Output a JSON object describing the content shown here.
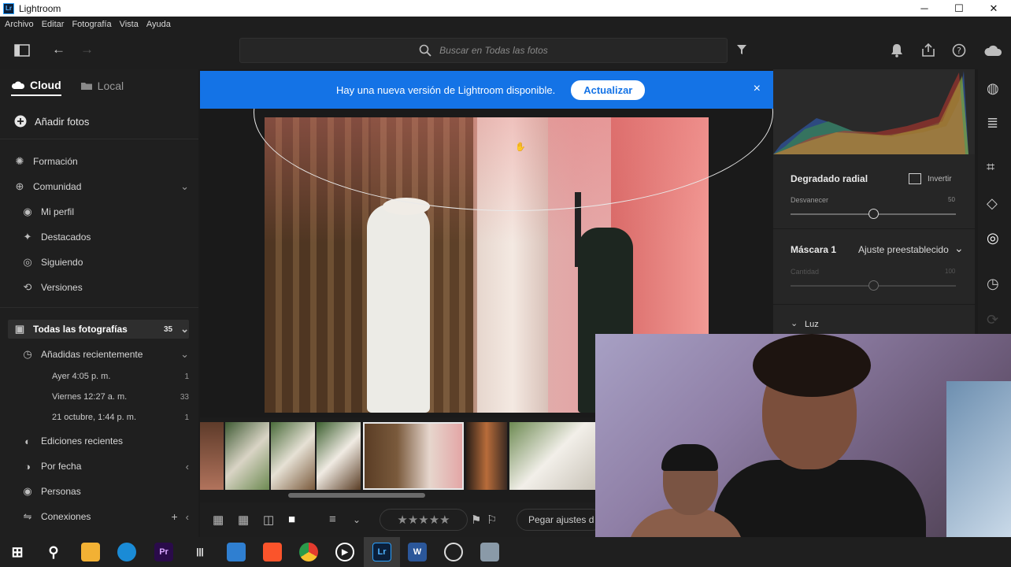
{
  "window": {
    "title": "Lightroom",
    "app_badge": "Lr",
    "controls": [
      "─",
      "☐",
      "✕"
    ]
  },
  "menu": [
    "Archivo",
    "Editar",
    "Fotografía",
    "Vista",
    "Ayuda"
  ],
  "search": {
    "placeholder": "Buscar en Todas las fotos"
  },
  "sidebar": {
    "tabs": [
      {
        "label": "Cloud",
        "active": true
      },
      {
        "label": "Local",
        "active": false
      }
    ],
    "add_photos": "Añadir fotos",
    "learn": "Formación",
    "community": {
      "label": "Comunidad",
      "items": [
        "Mi perfil",
        "Destacados",
        "Siguiendo",
        "Versiones"
      ]
    },
    "all_photos": {
      "label": "Todas las fotografías",
      "count": "35"
    },
    "recently_added": {
      "label": "Añadidas recientemente",
      "items": [
        {
          "label": "Ayer 4:05 p. m.",
          "count": "1"
        },
        {
          "label": "Viernes 12:27 a. m.",
          "count": "33"
        },
        {
          "label": "21 octubre, 1:44 p. m.",
          "count": "1"
        }
      ]
    },
    "recent_edits": "Ediciones recientes",
    "by_date": "Por fecha",
    "people": "Personas",
    "connections": "Conexiones"
  },
  "banner": {
    "text": "Hay una nueva versión de Lightroom disponible.",
    "button": "Actualizar",
    "close": "×"
  },
  "bottombar": {
    "stars": "★★★★★",
    "paste_label": "Pegar ajustes d"
  },
  "edit_panel": {
    "section_title": "Degradado radial",
    "invert_label": "Invertir",
    "feather_label": "Desvanecer",
    "feather_value": "50",
    "feather_fraction": 0.5,
    "mask_title": "Máscara 1",
    "preset_label": "Ajuste preestablecido",
    "amount_label": "Cantidad",
    "amount_value": "100",
    "amount_fraction": 0.5,
    "light_label": "Luz"
  },
  "taskbar": {
    "apps": [
      {
        "name": "start",
        "badge": "⊞"
      },
      {
        "name": "search",
        "badge": "⚲"
      },
      {
        "name": "file-explorer",
        "badge": ""
      },
      {
        "name": "edge",
        "badge": ""
      },
      {
        "name": "premiere",
        "badge": "Pr"
      },
      {
        "name": "audio-app",
        "badge": "|||"
      },
      {
        "name": "photos",
        "badge": ""
      },
      {
        "name": "brave",
        "badge": ""
      },
      {
        "name": "chrome",
        "badge": ""
      },
      {
        "name": "media-player",
        "badge": "▶"
      },
      {
        "name": "lightroom",
        "badge": "Lr"
      },
      {
        "name": "word",
        "badge": "W"
      },
      {
        "name": "speedtest",
        "badge": ""
      },
      {
        "name": "camera",
        "badge": ""
      }
    ],
    "colors": {
      "premiere": "#2a0b4a",
      "lightroom": "#0b1f3a",
      "word": "#2b579a",
      "chrome": "#e33b2e",
      "edge": "#1a8bd6",
      "brave": "#fb542b",
      "explorer": "#f2b134"
    }
  },
  "colors": {
    "accent": "#1473e6",
    "panel": "#1f1f1f",
    "background": "#1b1b1b"
  }
}
